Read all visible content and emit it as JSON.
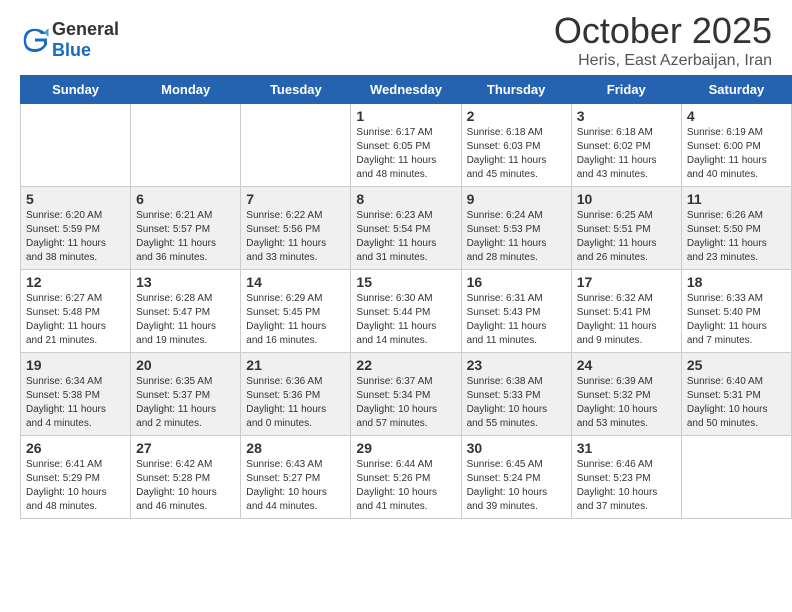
{
  "header": {
    "logo_general": "General",
    "logo_blue": "Blue",
    "month": "October 2025",
    "location": "Heris, East Azerbaijan, Iran"
  },
  "days_of_week": [
    "Sunday",
    "Monday",
    "Tuesday",
    "Wednesday",
    "Thursday",
    "Friday",
    "Saturday"
  ],
  "weeks": [
    [
      {
        "day": "",
        "info": ""
      },
      {
        "day": "",
        "info": ""
      },
      {
        "day": "",
        "info": ""
      },
      {
        "day": "1",
        "info": "Sunrise: 6:17 AM\nSunset: 6:05 PM\nDaylight: 11 hours\nand 48 minutes."
      },
      {
        "day": "2",
        "info": "Sunrise: 6:18 AM\nSunset: 6:03 PM\nDaylight: 11 hours\nand 45 minutes."
      },
      {
        "day": "3",
        "info": "Sunrise: 6:18 AM\nSunset: 6:02 PM\nDaylight: 11 hours\nand 43 minutes."
      },
      {
        "day": "4",
        "info": "Sunrise: 6:19 AM\nSunset: 6:00 PM\nDaylight: 11 hours\nand 40 minutes."
      }
    ],
    [
      {
        "day": "5",
        "info": "Sunrise: 6:20 AM\nSunset: 5:59 PM\nDaylight: 11 hours\nand 38 minutes."
      },
      {
        "day": "6",
        "info": "Sunrise: 6:21 AM\nSunset: 5:57 PM\nDaylight: 11 hours\nand 36 minutes."
      },
      {
        "day": "7",
        "info": "Sunrise: 6:22 AM\nSunset: 5:56 PM\nDaylight: 11 hours\nand 33 minutes."
      },
      {
        "day": "8",
        "info": "Sunrise: 6:23 AM\nSunset: 5:54 PM\nDaylight: 11 hours\nand 31 minutes."
      },
      {
        "day": "9",
        "info": "Sunrise: 6:24 AM\nSunset: 5:53 PM\nDaylight: 11 hours\nand 28 minutes."
      },
      {
        "day": "10",
        "info": "Sunrise: 6:25 AM\nSunset: 5:51 PM\nDaylight: 11 hours\nand 26 minutes."
      },
      {
        "day": "11",
        "info": "Sunrise: 6:26 AM\nSunset: 5:50 PM\nDaylight: 11 hours\nand 23 minutes."
      }
    ],
    [
      {
        "day": "12",
        "info": "Sunrise: 6:27 AM\nSunset: 5:48 PM\nDaylight: 11 hours\nand 21 minutes."
      },
      {
        "day": "13",
        "info": "Sunrise: 6:28 AM\nSunset: 5:47 PM\nDaylight: 11 hours\nand 19 minutes."
      },
      {
        "day": "14",
        "info": "Sunrise: 6:29 AM\nSunset: 5:45 PM\nDaylight: 11 hours\nand 16 minutes."
      },
      {
        "day": "15",
        "info": "Sunrise: 6:30 AM\nSunset: 5:44 PM\nDaylight: 11 hours\nand 14 minutes."
      },
      {
        "day": "16",
        "info": "Sunrise: 6:31 AM\nSunset: 5:43 PM\nDaylight: 11 hours\nand 11 minutes."
      },
      {
        "day": "17",
        "info": "Sunrise: 6:32 AM\nSunset: 5:41 PM\nDaylight: 11 hours\nand 9 minutes."
      },
      {
        "day": "18",
        "info": "Sunrise: 6:33 AM\nSunset: 5:40 PM\nDaylight: 11 hours\nand 7 minutes."
      }
    ],
    [
      {
        "day": "19",
        "info": "Sunrise: 6:34 AM\nSunset: 5:38 PM\nDaylight: 11 hours\nand 4 minutes."
      },
      {
        "day": "20",
        "info": "Sunrise: 6:35 AM\nSunset: 5:37 PM\nDaylight: 11 hours\nand 2 minutes."
      },
      {
        "day": "21",
        "info": "Sunrise: 6:36 AM\nSunset: 5:36 PM\nDaylight: 11 hours\nand 0 minutes."
      },
      {
        "day": "22",
        "info": "Sunrise: 6:37 AM\nSunset: 5:34 PM\nDaylight: 10 hours\nand 57 minutes."
      },
      {
        "day": "23",
        "info": "Sunrise: 6:38 AM\nSunset: 5:33 PM\nDaylight: 10 hours\nand 55 minutes."
      },
      {
        "day": "24",
        "info": "Sunrise: 6:39 AM\nSunset: 5:32 PM\nDaylight: 10 hours\nand 53 minutes."
      },
      {
        "day": "25",
        "info": "Sunrise: 6:40 AM\nSunset: 5:31 PM\nDaylight: 10 hours\nand 50 minutes."
      }
    ],
    [
      {
        "day": "26",
        "info": "Sunrise: 6:41 AM\nSunset: 5:29 PM\nDaylight: 10 hours\nand 48 minutes."
      },
      {
        "day": "27",
        "info": "Sunrise: 6:42 AM\nSunset: 5:28 PM\nDaylight: 10 hours\nand 46 minutes."
      },
      {
        "day": "28",
        "info": "Sunrise: 6:43 AM\nSunset: 5:27 PM\nDaylight: 10 hours\nand 44 minutes."
      },
      {
        "day": "29",
        "info": "Sunrise: 6:44 AM\nSunset: 5:26 PM\nDaylight: 10 hours\nand 41 minutes."
      },
      {
        "day": "30",
        "info": "Sunrise: 6:45 AM\nSunset: 5:24 PM\nDaylight: 10 hours\nand 39 minutes."
      },
      {
        "day": "31",
        "info": "Sunrise: 6:46 AM\nSunset: 5:23 PM\nDaylight: 10 hours\nand 37 minutes."
      },
      {
        "day": "",
        "info": ""
      }
    ]
  ]
}
